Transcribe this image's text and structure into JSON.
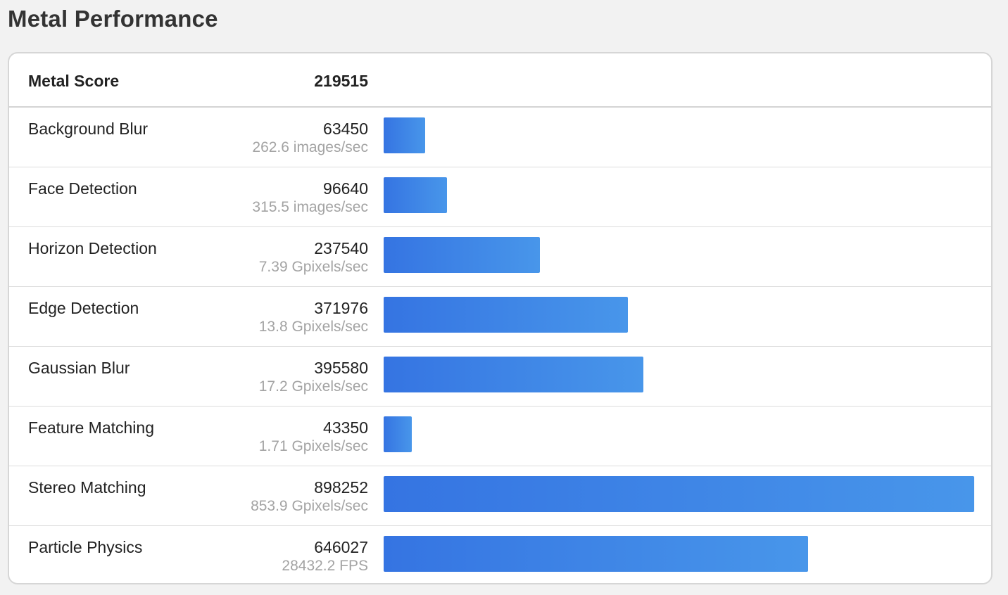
{
  "page": {
    "title": "Metal Performance"
  },
  "summary": {
    "label": "Metal Score",
    "value": "219515"
  },
  "benchmarks": [
    {
      "name": "Background Blur",
      "score": "63450",
      "rate": "262.6 images/sec",
      "value": 63450
    },
    {
      "name": "Face Detection",
      "score": "96640",
      "rate": "315.5 images/sec",
      "value": 96640
    },
    {
      "name": "Horizon Detection",
      "score": "237540",
      "rate": "7.39 Gpixels/sec",
      "value": 237540
    },
    {
      "name": "Edge Detection",
      "score": "371976",
      "rate": "13.8 Gpixels/sec",
      "value": 371976
    },
    {
      "name": "Gaussian Blur",
      "score": "395580",
      "rate": "17.2 Gpixels/sec",
      "value": 395580
    },
    {
      "name": "Feature Matching",
      "score": "43350",
      "rate": "1.71 Gpixels/sec",
      "value": 43350
    },
    {
      "name": "Stereo Matching",
      "score": "898252",
      "rate": "853.9 Gpixels/sec",
      "value": 898252
    },
    {
      "name": "Particle Physics",
      "score": "646027",
      "rate": "28432.2 FPS",
      "value": 646027
    }
  ],
  "colors": {
    "bar_start": "#3574e2",
    "bar_end": "#4896ea"
  }
}
